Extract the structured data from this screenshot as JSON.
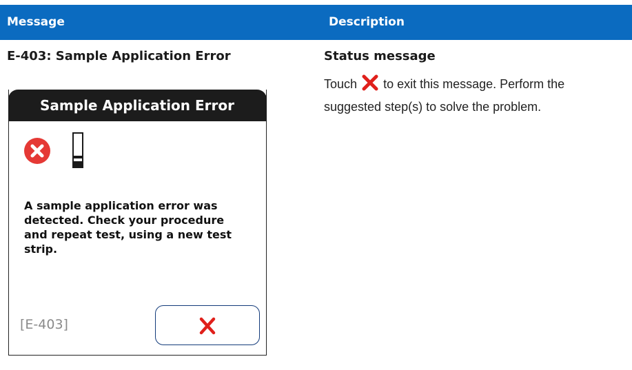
{
  "table": {
    "header": {
      "message": "Message",
      "description": "Description"
    },
    "row": {
      "message_title": "E-403: Sample Application Error",
      "description_title": "Status message",
      "description_before_icon": "Touch",
      "description_after_icon": " to exit this message. Perform the suggested step(s) to solve the problem."
    }
  },
  "dialog": {
    "title": "Sample Application Error",
    "message": "A sample application error was detected. Check your procedure and repeat test, using a new test strip.",
    "error_code": "[E-403]",
    "icons": [
      "error-circle-icon",
      "test-strip-icon",
      "close-x-icon"
    ]
  },
  "colors": {
    "header_bg": "#0b6bc0",
    "dialog_title_bg": "#1c1c1c",
    "error_red": "#e53935",
    "close_red": "#e0201b",
    "button_border": "#123a7a"
  }
}
